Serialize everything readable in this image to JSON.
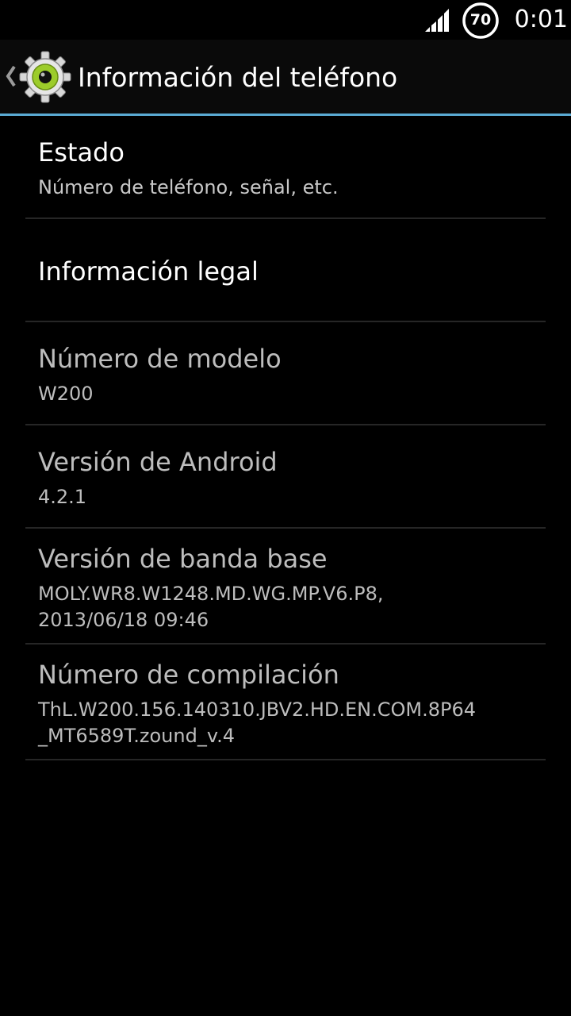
{
  "status_bar": {
    "signal_icon": "signal-strength-icon",
    "battery_level": "70",
    "battery_icon": "battery-ring-icon",
    "time": "0:01"
  },
  "action_bar": {
    "up_icon": "chevron-left-icon",
    "app_icon": "settings-gear-icon",
    "title": "Información del teléfono",
    "accent_color": "#5aaad4"
  },
  "items": [
    {
      "title": "Estado",
      "summary": "Número de teléfono, señal, etc.",
      "enabled": true
    },
    {
      "title": "Información legal",
      "summary": "",
      "enabled": true
    },
    {
      "title": "Número de modelo",
      "summary": "W200",
      "enabled": false
    },
    {
      "title": "Versión de Android",
      "summary": "4.2.1",
      "enabled": false
    },
    {
      "title": "Versión de banda base",
      "summary_line1": "MOLY.WR8.W1248.MD.WG.MP.V6.P8,",
      "summary_line2": "2013/06/18 09:46",
      "enabled": false
    },
    {
      "title": "Número de compilación",
      "summary_line1": "ThL.W200.156.140310.JBV2.HD.EN.COM.8P64",
      "summary_line2": "_MT6589T.zound_v.4",
      "enabled": false
    }
  ]
}
